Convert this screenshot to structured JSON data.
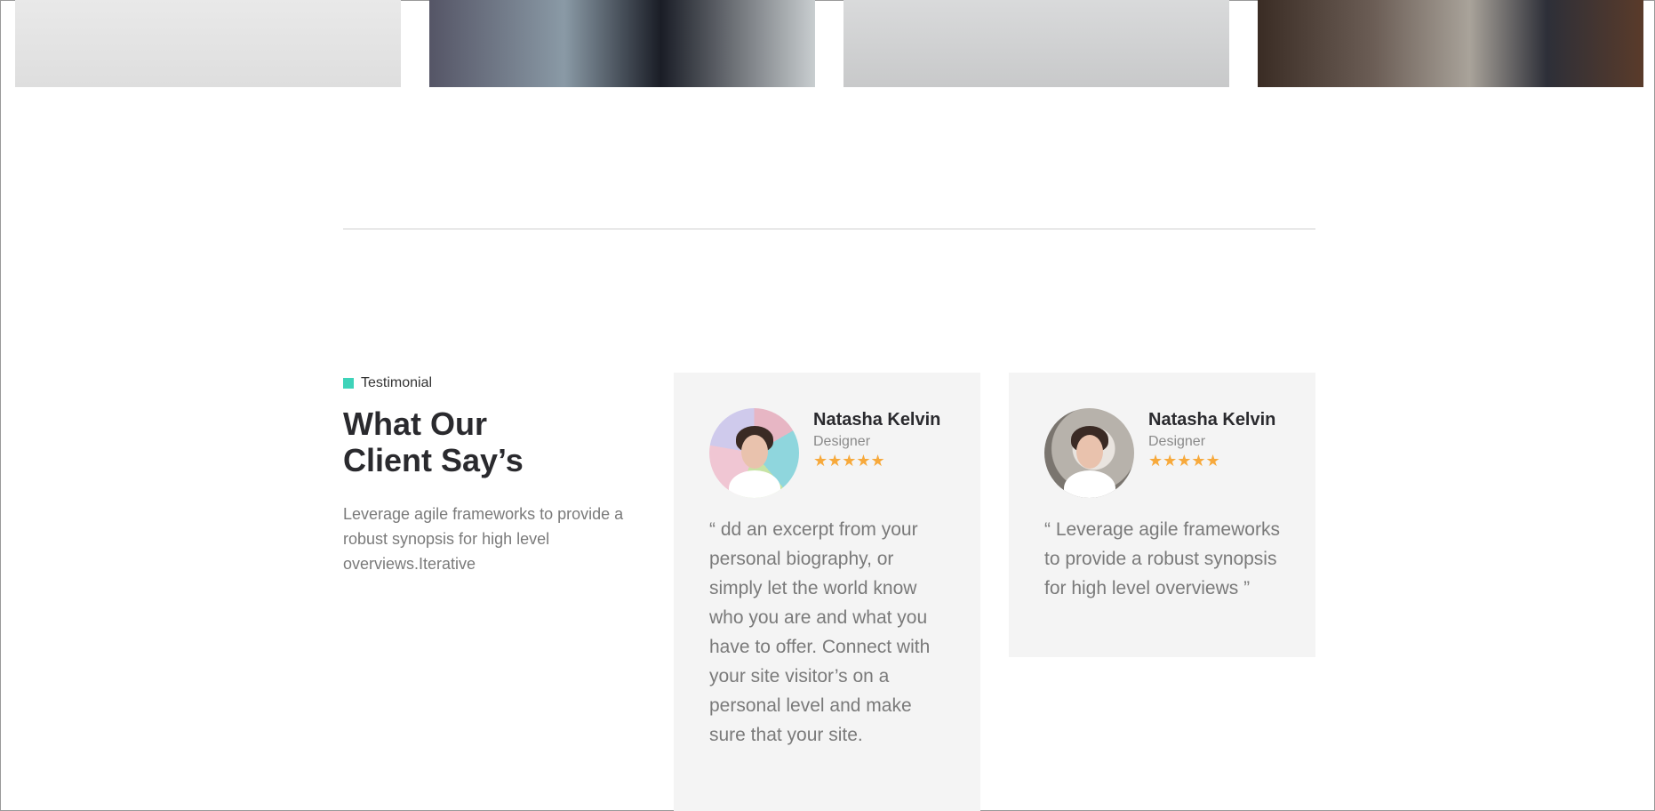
{
  "section": {
    "eyebrow_label": "Testimonial",
    "heading_line1": "What Our",
    "heading_line2": "Client Say’s",
    "lead": "Leverage agile frameworks to provide a robust synopsis for high level overviews.Iterative",
    "accent_color": "#3ed3b9",
    "star_color": "#f7a93b"
  },
  "testimonials": [
    {
      "name": "Natasha Kelvin",
      "role": "Designer",
      "rating": 5,
      "stars": "★★★★★",
      "quote": "“ dd an excerpt from your personal biography, or simply let the world know who you are and what you have to offer. Connect with your site visitor’s on a personal level and make sure that your site."
    },
    {
      "name": "Natasha Kelvin",
      "role": "Designer",
      "rating": 5,
      "stars": "★★★★★",
      "quote": "“ Leverage agile frameworks to provide a robust synopsis for high level overviews ”"
    }
  ]
}
